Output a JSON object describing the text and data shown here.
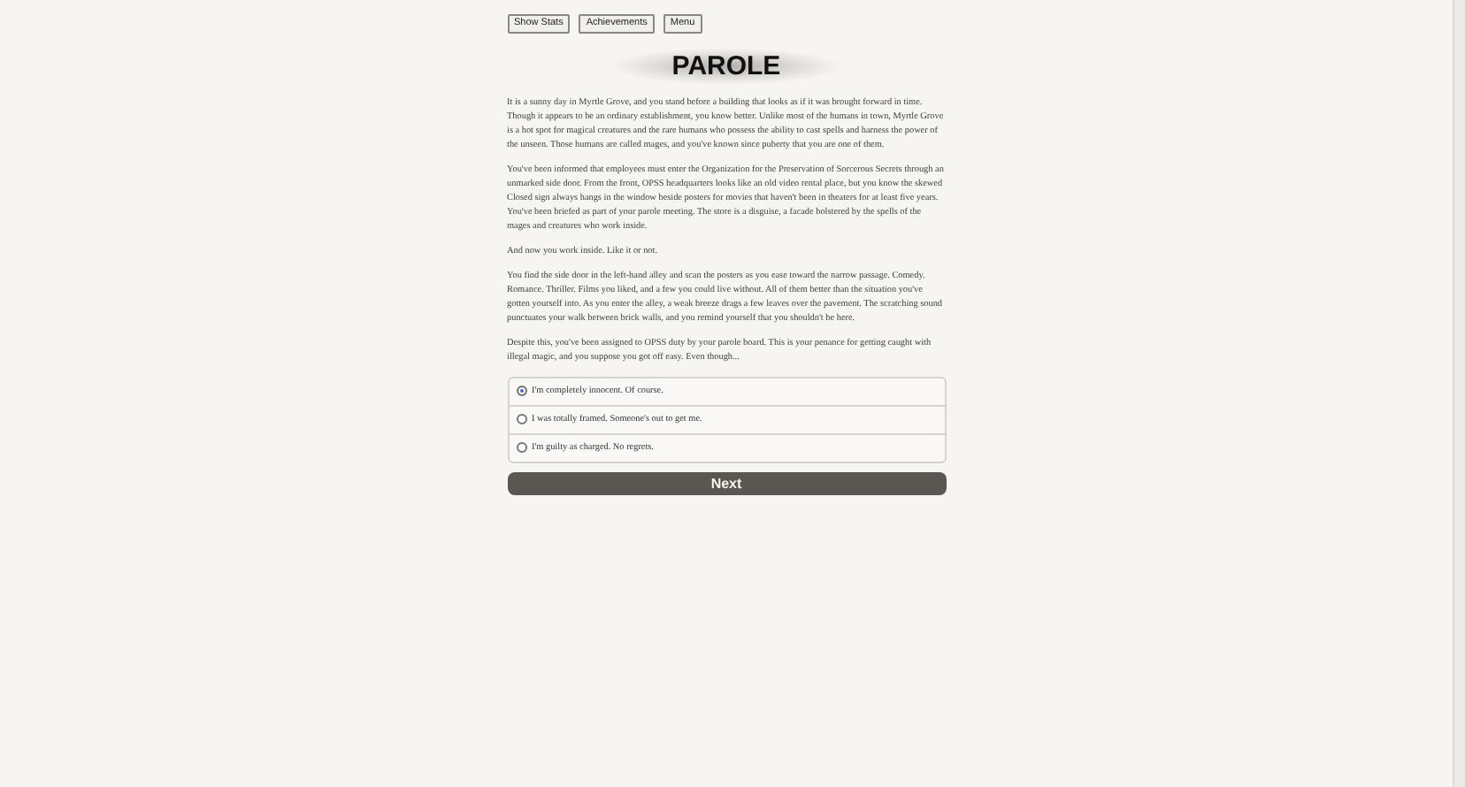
{
  "toolbar": [
    "Show Stats",
    "Achievements",
    "Menu"
  ],
  "title": "PAROLE",
  "paragraphs": [
    "It is a sunny day in Myrtle Grove, and you stand before a building that looks as if it was brought forward in time. Though it appears to be an ordinary establishment, you know better. Unlike most of the humans in town, Myrtle Grove is a hot spot for magical creatures and the rare humans who possess the ability to cast spells and harness the power of the unseen. Those humans are called mages, and you've known since puberty that you are one of them.",
    "You've been informed that employees must enter the Organization for the Preservation of Sorcerous Secrets through an unmarked side door. From the front, OPSS headquarters looks like an old video rental place, but you know the skewed Closed sign always hangs in the window beside posters for movies that haven't been in theaters for at least five years. You've been briefed as part of your parole meeting. The store is a disguise, a facade bolstered by the spells of the mages and creatures who work inside.",
    "And now you work inside. Like it or not.",
    "You find the side door in the left-hand alley and scan the posters as you ease toward the narrow passage. Comedy. Romance. Thriller. Films you liked, and a few you could live without. All of them better than the situation you've gotten yourself into. As you enter the alley, a weak breeze drags a few leaves over the pavement. The scratching sound punctuates your walk between brick walls, and you remind yourself that you shouldn't be here.",
    "Despite this, you've been assigned to OPSS duty by your parole board. This is your penance for getting caught with illegal magic, and you suppose you got off easy. Even though..."
  ],
  "choices": [
    {
      "label": "I'm completely innocent. Of course.",
      "selected": true
    },
    {
      "label": "I was totally framed. Someone's out to get me.",
      "selected": false
    },
    {
      "label": "I'm guilty as charged. No regrets.",
      "selected": false
    }
  ],
  "next_button": "Next"
}
